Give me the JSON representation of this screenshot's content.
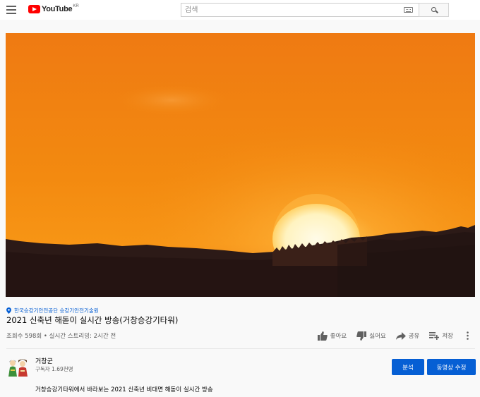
{
  "header": {
    "logo_text": "YouTube",
    "logo_region": "KR",
    "search_placeholder": "검색"
  },
  "video": {
    "location": "한국승강기안전공단 승강기안전기술원",
    "title": "2021 신축년 해돋이 실시간 방송(거창승강기타워)",
    "meta": "조회수 598회 • 실시간 스트리밍: 2시간 전"
  },
  "actions": {
    "like": "좋아요",
    "dislike": "싫어요",
    "share": "공유",
    "save": "저장"
  },
  "channel": {
    "name": "거창군",
    "subscribers": "구독자 1.69천명"
  },
  "buttons": {
    "analytics": "분석",
    "edit_video": "동영상 수정"
  },
  "description": "거창승강기타워에서 바라보는 2021 신축년 비대면 해돋이 실시간 방송",
  "colors": {
    "brand_red": "#ff0000",
    "accent_blue": "#065fd4",
    "sky_orange": "#f07a10"
  }
}
